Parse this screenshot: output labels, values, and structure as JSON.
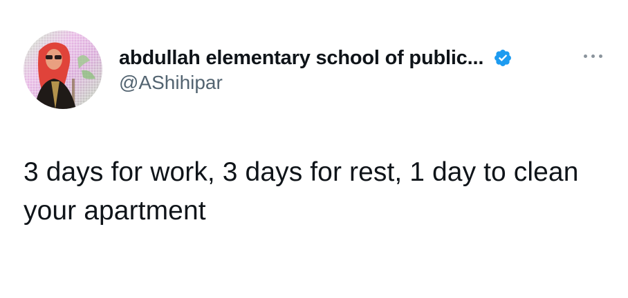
{
  "tweet": {
    "author": {
      "display_name": "abdullah elementary school of public...",
      "handle": "@AShihipar",
      "verified": true,
      "avatar_icon": "profile-avatar"
    },
    "text": "3 days for work, 3 days for rest, 1 day to clean your apartment",
    "menu_icon": "more-options-icon"
  },
  "colors": {
    "verified_badge": "#1d9bf0",
    "handle_text": "#536471",
    "body_text": "#0f1419"
  }
}
